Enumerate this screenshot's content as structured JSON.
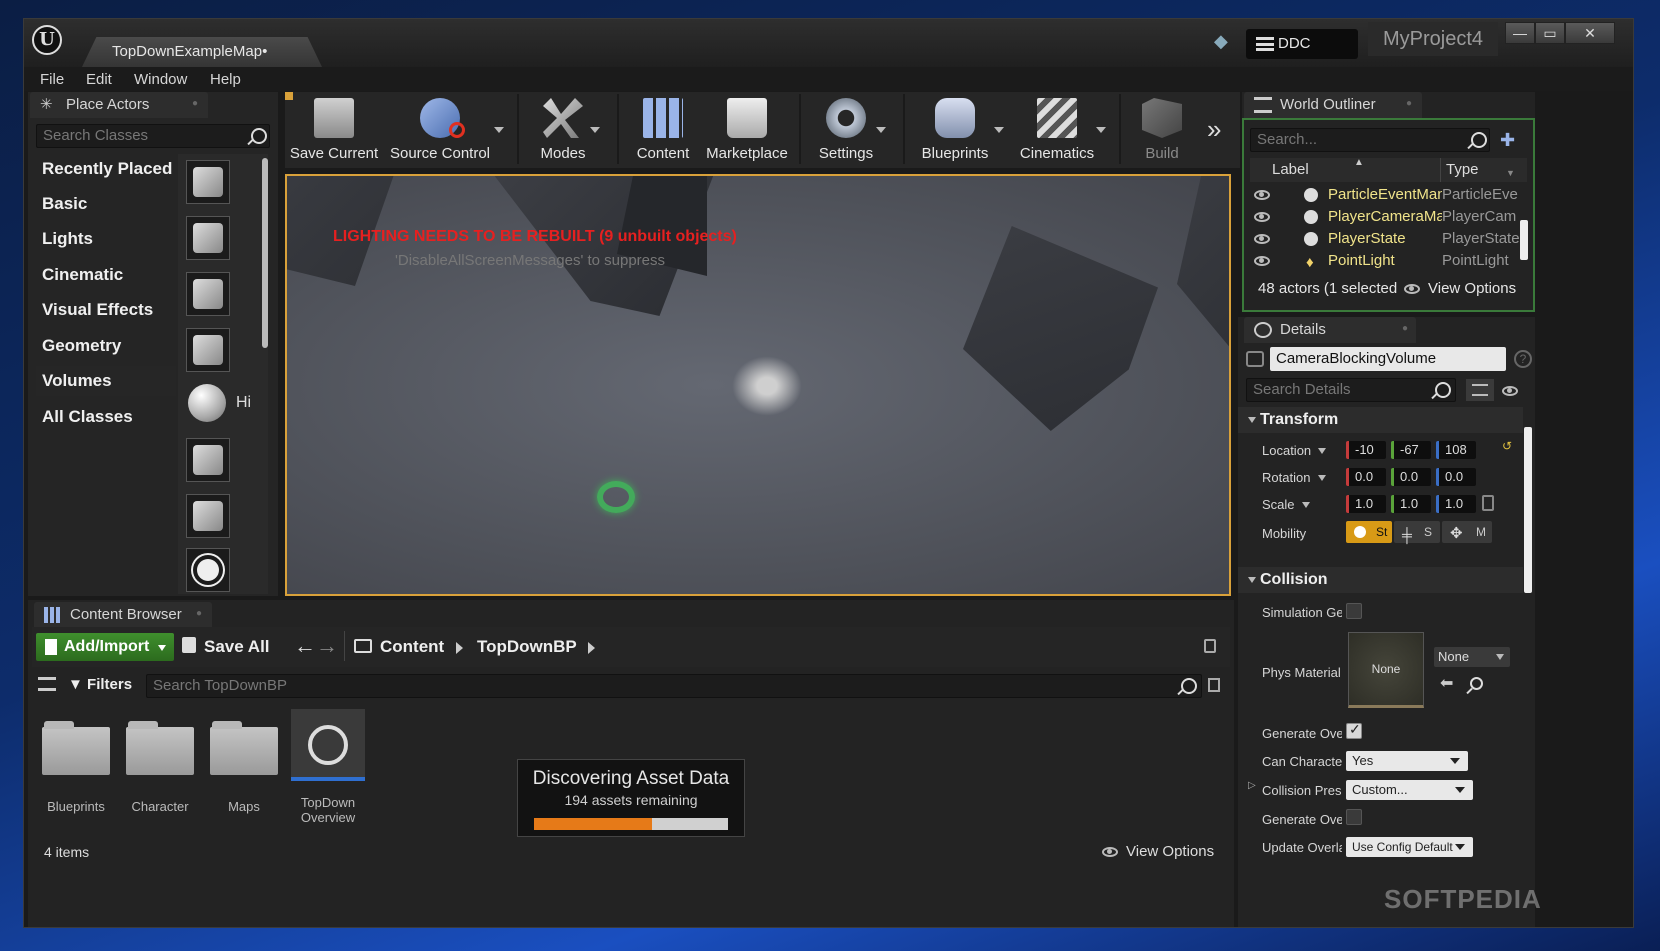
{
  "window": {
    "doc_tab": "TopDownExampleMap•",
    "ddc_label": "DDC",
    "project_name": "MyProject4",
    "controls": {
      "minimize": "—",
      "maximize": "▭",
      "close": "✕"
    }
  },
  "menu": [
    "File",
    "Edit",
    "Window",
    "Help"
  ],
  "place_actors": {
    "tab_label": "Place Actors",
    "search_placeholder": "Search Classes",
    "categories": [
      "Recently Placed",
      "Basic",
      "Lights",
      "Cinematic",
      "Visual Effects",
      "Geometry",
      "Volumes",
      "All Classes"
    ],
    "selected_category": "Volumes",
    "partial_label": "Hi"
  },
  "toolbar": {
    "save_current": "Save Current",
    "source_control": "Source Control",
    "modes": "Modes",
    "content": "Content",
    "marketplace": "Marketplace",
    "settings": "Settings",
    "blueprints": "Blueprints",
    "cinematics": "Cinematics",
    "build": "Build"
  },
  "viewport": {
    "lighting_warning": "LIGHTING NEEDS TO BE REBUILT (9 unbuilt objects)",
    "suppress_hint": "'DisableAllScreenMessages' to suppress"
  },
  "content_browser": {
    "tab_label": "Content Browser",
    "add_import": "Add/Import",
    "save_all": "Save All",
    "breadcrumb": [
      "Content",
      "TopDownBP"
    ],
    "filters": "Filters",
    "search_placeholder": "Search TopDownBP",
    "items": [
      "Blueprints",
      "Character",
      "Maps",
      "TopDown Overview"
    ],
    "item_count": "4 items",
    "view_options": "View Options",
    "progress": {
      "title": "Discovering Asset Data",
      "subtitle": "194 assets remaining",
      "fraction": 0.61
    }
  },
  "world_outliner": {
    "tab_label": "World Outliner",
    "search_placeholder": "Search...",
    "col_label": "Label",
    "col_type": "Type",
    "rows": [
      {
        "label": "ParticleEventMan",
        "type": "ParticleEve"
      },
      {
        "label": "PlayerCameraMan",
        "type": "PlayerCam"
      },
      {
        "label": "PlayerState",
        "type": "PlayerState"
      },
      {
        "label": "PointLight",
        "type": "PointLight"
      }
    ],
    "status": "48 actors (1 selected",
    "view_options": "View Options"
  },
  "details": {
    "tab_label": "Details",
    "object_name": "CameraBlockingVolume",
    "search_placeholder": "Search Details",
    "transform_section": "Transform",
    "location_label": "Location",
    "location": [
      "-10",
      "-67",
      "108"
    ],
    "rotation_label": "Rotation",
    "rotation": [
      "0.0",
      "0.0",
      "0.0"
    ],
    "scale_label": "Scale",
    "scale": [
      "1.0",
      "1.0",
      "1.0"
    ],
    "mobility_label": "Mobility",
    "mobility_options": [
      "St",
      "S",
      "M"
    ],
    "collision_section": "Collision",
    "simulation_label": "Simulation Ger",
    "phys_material_label": "Phys Material",
    "phys_material_value": "None",
    "phys_material_combo": "None",
    "generate_overlap_label": "Generate Over",
    "can_character_label": "Can Character",
    "can_character_value": "Yes",
    "collision_preset_label": "Collision Prese",
    "collision_preset_value": "Custom...",
    "generate_overlap2_label": "Generate Over",
    "update_overlap_label": "Update Overla",
    "update_overlap_value": "Use Config Default"
  },
  "watermark": "SOFTPEDIA"
}
